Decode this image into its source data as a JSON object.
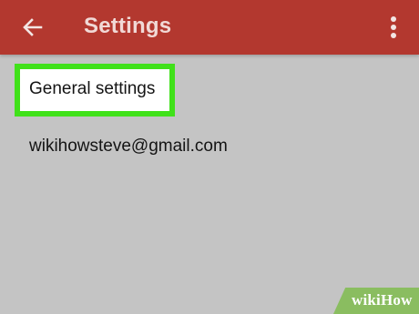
{
  "app_bar": {
    "title": "Settings",
    "back_icon": "arrow-left-icon",
    "overflow_icon": "more-vert-icon",
    "background_color": "#b3382f",
    "title_color": "#f1d9d6"
  },
  "settings_list": {
    "items": [
      {
        "label": "General settings",
        "highlighted": true,
        "highlight_color": "#40e11a"
      },
      {
        "label": "wikihowsteve@gmail.com",
        "highlighted": false
      }
    ]
  },
  "watermark": {
    "text": "wikiHow",
    "color": "#8abd60"
  },
  "content_background": "#c4c4c4"
}
